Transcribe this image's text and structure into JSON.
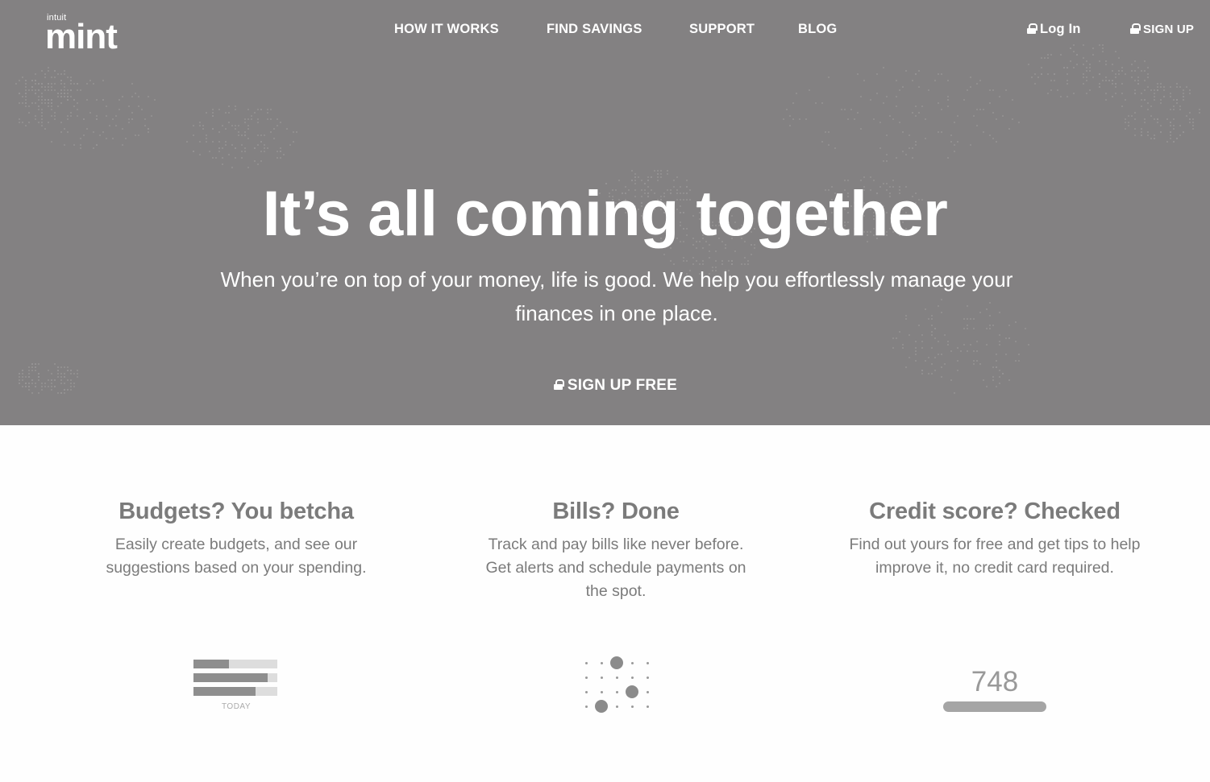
{
  "brand": {
    "small": "intuit",
    "name": "mint"
  },
  "nav": [
    "HOW IT WORKS",
    "FIND SAVINGS",
    "SUPPORT",
    "BLOG"
  ],
  "auth": {
    "login": "Log In",
    "signup": "SIGN UP"
  },
  "hero": {
    "headline": "It’s all coming together",
    "subtitle": "When you’re on top of your money, life is good. We help you effortlessly manage your finances in one place.",
    "cta": "SIGN UP FREE"
  },
  "features": [
    {
      "title": "Budgets? You betcha",
      "text": "Easily create budgets, and see our suggestions based on your spending."
    },
    {
      "title": "Bills? Done",
      "text": "Track and pay bills like never before. Get alerts and schedule payments on the spot."
    },
    {
      "title": "Credit score? Checked",
      "text": "Find out yours for free and get tips to help improve it, no credit card required."
    }
  ],
  "illustrations": {
    "budget_label": "TODAY",
    "budget_fill_fractions": [
      0.42,
      0.88,
      0.74
    ],
    "credit_score": "748"
  },
  "colors": {
    "hero_bg": "#838182",
    "text": "#7b7b7b",
    "page_bg": "#fefefe"
  }
}
